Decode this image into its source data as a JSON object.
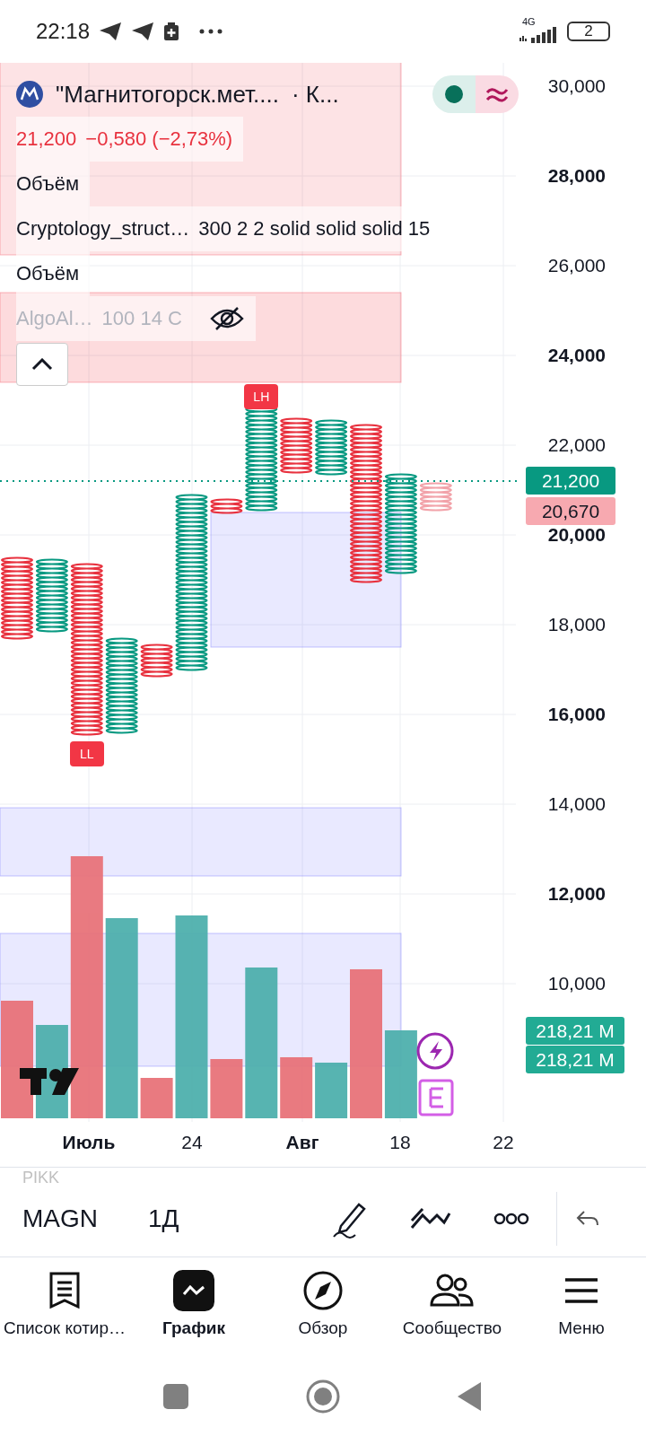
{
  "status_bar": {
    "time": "22:18",
    "network": "4G",
    "battery": "2"
  },
  "legend": {
    "symbol": "\"Магнитогорск.мет....",
    "exchange": "· К...",
    "price": "21,200",
    "change": "−0,580 (−2,73%)",
    "indicators": [
      {
        "name": "Объём",
        "hidden": false
      },
      {
        "name": "Cryptology_struct…",
        "params": "300 2 2 solid solid solid 15",
        "hidden": false
      },
      {
        "name": "Объём",
        "hidden": false
      },
      {
        "name": "AlgoAl…",
        "params": "100 14 C",
        "hidden": true
      }
    ]
  },
  "price_axis": [
    {
      "text": "30,000",
      "major": false
    },
    {
      "text": "28,000",
      "major": true
    },
    {
      "text": "26,000",
      "major": false
    },
    {
      "text": "24,000",
      "major": true
    },
    {
      "text": "22,000",
      "major": false
    },
    {
      "text": "20,000",
      "major": true
    },
    {
      "text": "18,000",
      "major": false
    },
    {
      "text": "16,000",
      "major": true
    },
    {
      "text": "14,000",
      "major": false
    },
    {
      "text": "12,000",
      "major": true
    },
    {
      "text": "10,000",
      "major": false
    }
  ],
  "price_labels": [
    {
      "text": "21,200",
      "kind": "last"
    },
    {
      "text": "20,670",
      "kind": "previous"
    }
  ],
  "volume_labels": [
    "218,21 M",
    "218,21 M"
  ],
  "markers": [
    {
      "text": "LH"
    },
    {
      "text": "LL"
    }
  ],
  "time_axis": [
    {
      "text": "Июль",
      "major": true
    },
    {
      "text": "24",
      "major": false
    },
    {
      "text": "Авг",
      "major": true
    },
    {
      "text": "18",
      "major": false
    },
    {
      "text": "22",
      "major": false
    }
  ],
  "toolbar": {
    "ticker_above": "PIKK",
    "ticker": "MAGN",
    "interval": "1Д"
  },
  "nav": [
    {
      "label": "Список котир…",
      "selected": false
    },
    {
      "label": "График",
      "selected": true
    },
    {
      "label": "Обзор",
      "selected": false
    },
    {
      "label": "Сообщество",
      "selected": false
    },
    {
      "label": "Меню",
      "selected": false
    }
  ]
}
